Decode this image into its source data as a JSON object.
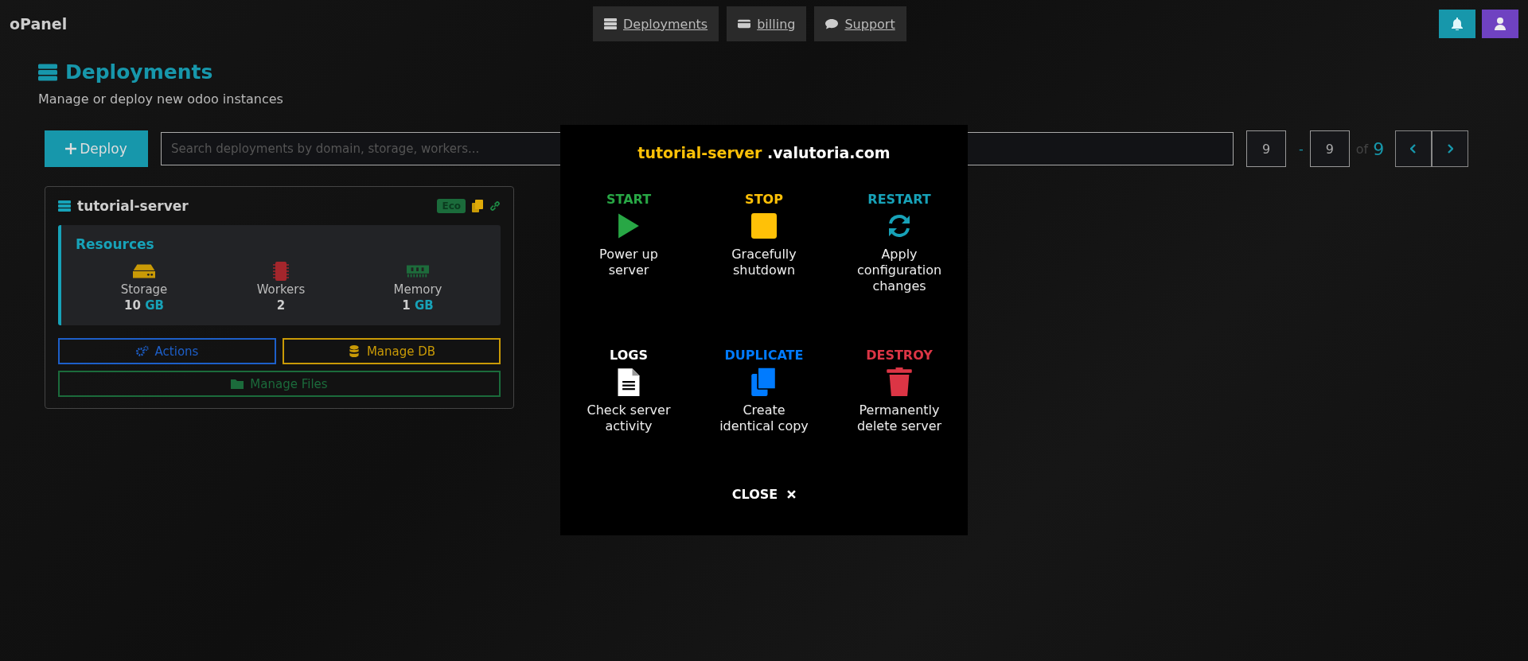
{
  "brand": "oPanel",
  "nav": [
    {
      "kind": "servers",
      "label": "Deployments"
    },
    {
      "kind": "card",
      "label": "billing"
    },
    {
      "kind": "chat",
      "label": "Support"
    }
  ],
  "page": {
    "title": "Deployments",
    "subtitle": "Manage or deploy new odoo instances"
  },
  "toolbar": {
    "deploy": "Deploy",
    "search": {
      "placeholder": "Search deployments by domain, storage, workers..."
    },
    "from": "9",
    "dash": "-",
    "to": "9",
    "of": "of",
    "total": "9"
  },
  "deployment": {
    "name": "tutorial-server",
    "plan": "Eco",
    "resources_title": "Resources",
    "resources": [
      {
        "kind": "storage",
        "label": "Storage",
        "value": "10",
        "unit": "GB"
      },
      {
        "kind": "workers",
        "label": "Workers",
        "value": "2"
      },
      {
        "kind": "memory",
        "label": "Memory",
        "value": "1",
        "unit": "GB"
      }
    ],
    "buttons": [
      {
        "kind": "actions",
        "label": "Actions"
      },
      {
        "kind": "db",
        "label": "Manage DB"
      },
      {
        "kind": "files",
        "label": "Manage Files"
      }
    ]
  },
  "modal": {
    "name": "tutorial-server",
    "domain": ".valutoria.com",
    "actions": [
      {
        "kind": "start",
        "title": "START",
        "description": "Power up server",
        "color": "#28a745"
      },
      {
        "kind": "stop",
        "title": "STOP",
        "description": "Gracefully shutdown",
        "color": "#ffc107"
      },
      {
        "kind": "restart",
        "title": "RESTART",
        "description": "Apply configuration changes",
        "color": "#17a2b8"
      },
      {
        "kind": "logs",
        "title": "LOGS",
        "description": "Check server activity",
        "color": "#ffffff"
      },
      {
        "kind": "duplicate",
        "title": "DUPLICATE",
        "description": "Create identical copy",
        "color": "#007bff"
      },
      {
        "kind": "destroy",
        "title": "DESTROY",
        "description": "Permanently delete server",
        "color": "#dc3545"
      }
    ],
    "close": "CLOSE"
  }
}
